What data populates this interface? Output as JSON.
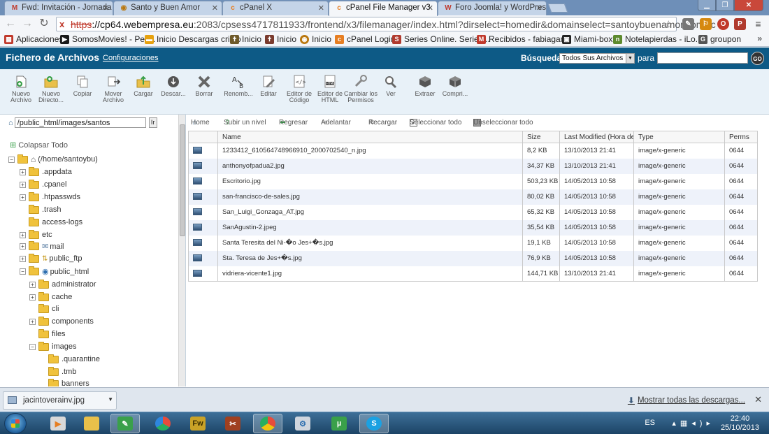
{
  "browser": {
    "tabs": [
      {
        "title": "Fwd: Invitación - Jornada",
        "favicon": "gmail-icon",
        "color": "#c0392b"
      },
      {
        "title": "Santo y Buen Amor",
        "favicon": "globe-icon",
        "color": "#b9770e"
      },
      {
        "title": "cPanel X",
        "favicon": "cpanel-icon",
        "color": "#e67e22"
      },
      {
        "title": "cPanel File Manager v3",
        "favicon": "cpanel-icon",
        "color": "#e67e22"
      },
      {
        "title": "Foro Joomla! y WordPress",
        "favicon": "joomla-icon",
        "color": "#c0392b"
      }
    ],
    "url": {
      "scheme": "https",
      "host": "://cp64.webempresa.eu",
      "rest": ":2083/cpsess4717811933/frontend/x3/filemanager/index.html?dirselect=homedir&domainselect=santoybuenamor.com&c"
    },
    "bookmarks": [
      {
        "label": "Aplicaciones",
        "icon": "apps-icon",
        "color": "#c0392b"
      },
      {
        "label": "SomosMovies! - Peli...",
        "icon": "film-icon",
        "color": "#1a1a1a"
      },
      {
        "label": "Inicio Descargas cristo",
        "icon": "folder-icon",
        "color": "#e6a10e"
      },
      {
        "label": "Inicio",
        "icon": "site-icon",
        "color": "#6e5a2a"
      },
      {
        "label": "Inicio",
        "icon": "site-icon",
        "color": "#7a3b2e"
      },
      {
        "label": "Inicio",
        "icon": "globe-icon",
        "color": "#b9770e"
      },
      {
        "label": "cPanel Login",
        "icon": "cpanel-icon",
        "color": "#e67e22"
      },
      {
        "label": "Series Online. Series...",
        "icon": "sp-icon",
        "color": "#b03a2e"
      },
      {
        "label": "Recibidos - fabiagar...",
        "icon": "gmail-icon",
        "color": "#c0392b"
      },
      {
        "label": "Miami-box",
        "icon": "box-icon",
        "color": "#222"
      },
      {
        "label": "Notelapierdas - iLo...",
        "icon": "note-icon",
        "color": "#5d8a2e"
      },
      {
        "label": "groupon",
        "icon": "groupon-icon",
        "color": "#555"
      }
    ],
    "bookmarks_more": "»"
  },
  "header": {
    "title": "Fichero de Archivos",
    "config_link": "Configuraciones",
    "search_label": "Búsqueda",
    "search_scope": "Todos Sus Archivos",
    "para_label": "para",
    "search_value": "",
    "go_label": "GO"
  },
  "tools": [
    {
      "label": "Nuevo Archivo",
      "icon": "new-file-icon"
    },
    {
      "label": "Nuevo Directo...",
      "icon": "new-folder-icon"
    },
    {
      "label": "Copiar",
      "icon": "copy-icon"
    },
    {
      "label": "Mover Archivo",
      "icon": "move-icon"
    },
    {
      "label": "Cargar",
      "icon": "upload-icon"
    },
    {
      "label": "Descar...",
      "icon": "download-icon"
    },
    {
      "label": "Borrar",
      "icon": "delete-icon"
    },
    {
      "label": "Renomb...",
      "icon": "rename-icon"
    },
    {
      "label": "Editar",
      "icon": "edit-icon"
    },
    {
      "label": "Editor de Código",
      "icon": "code-editor-icon"
    },
    {
      "label": "Editor de HTML",
      "icon": "html-editor-icon"
    },
    {
      "label": "Cambiar los Permisos",
      "icon": "permissions-icon"
    },
    {
      "label": "Ver",
      "icon": "view-icon"
    },
    {
      "label": "Extraer",
      "icon": "extract-icon"
    },
    {
      "label": "Compri...",
      "icon": "compress-icon"
    }
  ],
  "tree": {
    "path_value": "/public_html/images/santos",
    "path_go": "Ir",
    "collapse_all": "Colapsar Todo",
    "root_label": "(/home/santoybu)",
    "nodes": [
      {
        "label": ".appdata",
        "expander": "+"
      },
      {
        "label": ".cpanel",
        "expander": "+"
      },
      {
        "label": ".htpasswds",
        "expander": "+"
      },
      {
        "label": ".trash",
        "expander": ""
      },
      {
        "label": "access-logs",
        "expander": ""
      },
      {
        "label": "etc",
        "expander": "+"
      },
      {
        "label": "mail",
        "expander": "+"
      },
      {
        "label": "public_ftp",
        "expander": "+"
      },
      {
        "label": "public_html",
        "expander": "−"
      },
      {
        "label": "administrator",
        "expander": "+"
      },
      {
        "label": "cache",
        "expander": "+"
      },
      {
        "label": "cli",
        "expander": ""
      },
      {
        "label": "components",
        "expander": "+"
      },
      {
        "label": "files",
        "expander": ""
      },
      {
        "label": "images",
        "expander": "−"
      },
      {
        "label": ".quarantine",
        "expander": ""
      },
      {
        "label": ".tmb",
        "expander": ""
      },
      {
        "label": "banners",
        "expander": ""
      }
    ]
  },
  "navbar": {
    "home": "Home",
    "up": "Subir un nivel",
    "back": "Regresar",
    "forward": "Adelantar",
    "reload": "Recargar",
    "select_all": "Seleccionar todo",
    "unselect_all": "Unseleccionar todo"
  },
  "table": {
    "columns": {
      "name": "Name",
      "size": "Size",
      "modified": "Last Modified (Hora de ve",
      "type": "Type",
      "perms": "Perms"
    },
    "rows": [
      {
        "name": "1233412_610564748966910_2000702540_n.jpg",
        "size": "8,2 KB",
        "modified": "13/10/2013 21:41",
        "type": "image/x-generic",
        "perms": "0644"
      },
      {
        "name": "anthonyofpadua2.jpg",
        "size": "34,37 KB",
        "modified": "13/10/2013 21:41",
        "type": "image/x-generic",
        "perms": "0644"
      },
      {
        "name": "Escritorio.jpg",
        "size": "503,23 KB",
        "modified": "14/05/2013 10:58",
        "type": "image/x-generic",
        "perms": "0644"
      },
      {
        "name": "san-francisco-de-sales.jpg",
        "size": "80,02 KB",
        "modified": "14/05/2013 10:58",
        "type": "image/x-generic",
        "perms": "0644"
      },
      {
        "name": "San_Luigi_Gonzaga_AT.jpg",
        "size": "65,32 KB",
        "modified": "14/05/2013 10:58",
        "type": "image/x-generic",
        "perms": "0644"
      },
      {
        "name": "SanAgustin-2.jpeg",
        "size": "35,54 KB",
        "modified": "14/05/2013 10:58",
        "type": "image/x-generic",
        "perms": "0644"
      },
      {
        "name": "Santa Teresita del Ni-�o Jes+�s.jpg",
        "size": "19,1 KB",
        "modified": "14/05/2013 10:58",
        "type": "image/x-generic",
        "perms": "0644"
      },
      {
        "name": "Sta. Teresa de Jes+�s.jpg",
        "size": "76,9 KB",
        "modified": "14/05/2013 10:58",
        "type": "image/x-generic",
        "perms": "0644"
      },
      {
        "name": "vidriera-vicente1.jpg",
        "size": "144,71 KB",
        "modified": "13/10/2013 21:41",
        "type": "image/x-generic",
        "perms": "0644"
      }
    ]
  },
  "downloads": {
    "file": "jacintoverainv.jpg",
    "show_all": "Mostrar todas las descargas..."
  },
  "taskbar": {
    "language": "ES",
    "time": "22:40",
    "date": "25/10/2013"
  },
  "colors": {
    "header_bg": "#0d5a86",
    "toolbar_bg": "#e8f1f8",
    "row_alt": "#eef2fa",
    "taskbar": "#1c4466"
  }
}
